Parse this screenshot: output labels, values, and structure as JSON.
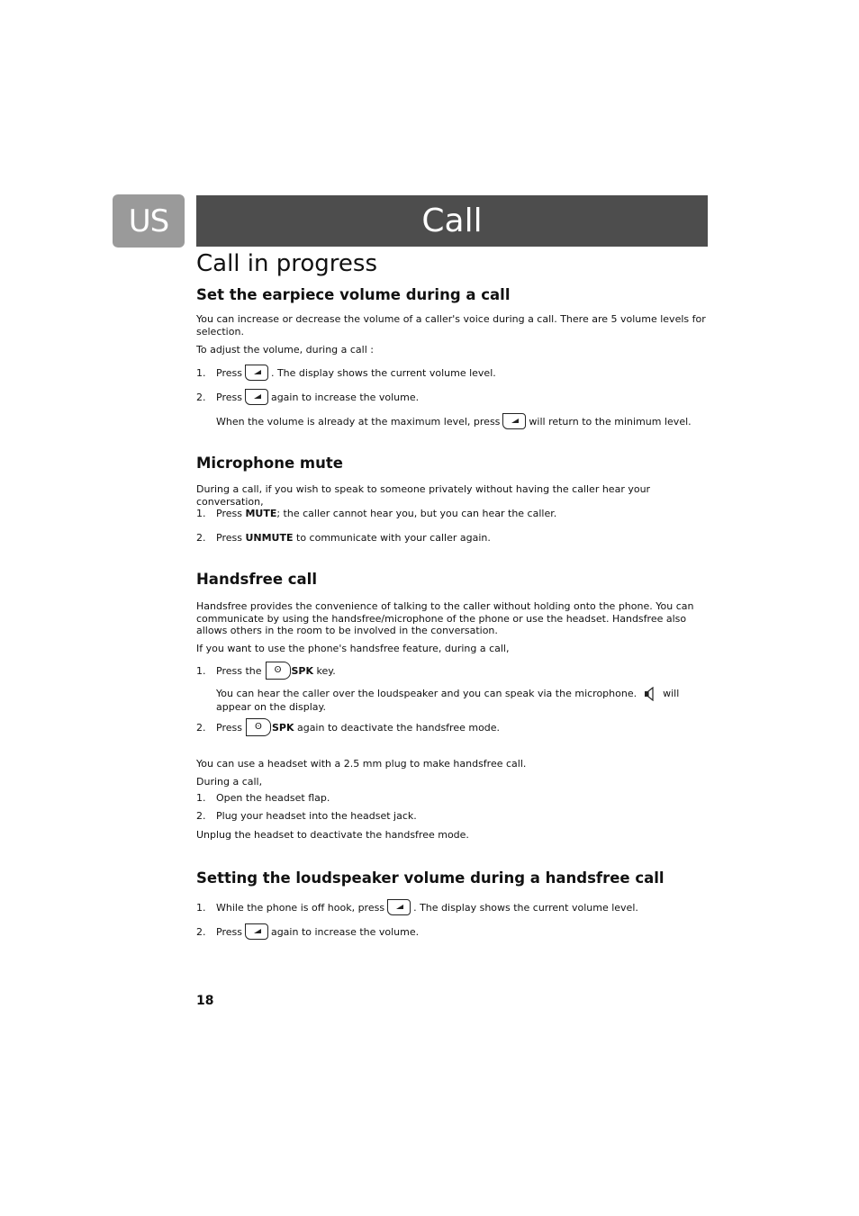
{
  "header": {
    "language_tab": "US",
    "chapter_title": "Call"
  },
  "section_title": "Call in progress",
  "earpiece": {
    "heading": "Set the earpiece volume during a call",
    "intro": "You can increase or decrease the volume of a caller's voice during a call. There are 5 volume levels for selection.",
    "lead": "To adjust the volume, during a call :",
    "step1_num": "1.",
    "step1_pre": "Press",
    "step1_post": ". The display shows the current volume level.",
    "step2_num": "2.",
    "step2_pre": "Press",
    "step2_post": "again to increase the volume.",
    "note_pre": "When the volume is already at the maximum level, press",
    "note_post": "will return to the minimum level."
  },
  "mute": {
    "heading": "Microphone mute",
    "intro": "During a call, if you wish to speak to someone privately without having the caller hear your conversation,",
    "step1_num": "1.",
    "step1_pre": "Press",
    "step1_key": "MUTE",
    "step1_post": "; the caller cannot hear you, but you can hear the caller.",
    "step2_num": "2.",
    "step2_pre": "Press",
    "step2_key": "UNMUTE",
    "step2_post": "to communicate with your caller again."
  },
  "handsfree": {
    "heading": "Handsfree call",
    "intro": "Handsfree provides the convenience of talking to the caller without holding onto the phone. You can communicate by using the handsfree/microphone of the phone or use the headset. Handsfree also allows others in the room to be involved in the conversation.",
    "lead": "If you want to use the phone's handsfree feature, during a call,",
    "step1_num": "1.",
    "step1_pre": "Press the",
    "step1_key": "SPK",
    "step1_post": "key.",
    "note_pre": "You can hear the caller over the loudspeaker and you can speak via the microphone.",
    "note_post": "will appear on the display.",
    "step2_num": "2.",
    "step2_pre": "Press",
    "step2_key": "SPK",
    "step2_post": "again to deactivate the handsfree mode.",
    "headset_intro": "You can use a headset with a 2.5 mm plug to make handsfree call.",
    "headset_lead": "During a call,",
    "headset_step1_num": "1.",
    "headset_step1": "Open the headset flap.",
    "headset_step2_num": "2.",
    "headset_step2": "Plug your headset into the headset jack.",
    "headset_outro": "Unplug the headset to deactivate the handsfree mode."
  },
  "loudspeaker": {
    "heading": "Setting the loudspeaker volume during a handsfree call",
    "step1_num": "1.",
    "step1_pre": "While the phone is off hook, press",
    "step1_post": ". The display shows the current volume level.",
    "step2_num": "2.",
    "step2_pre": "Press",
    "step2_post": "again to increase the volume."
  },
  "footer": {
    "page_number": "18"
  }
}
